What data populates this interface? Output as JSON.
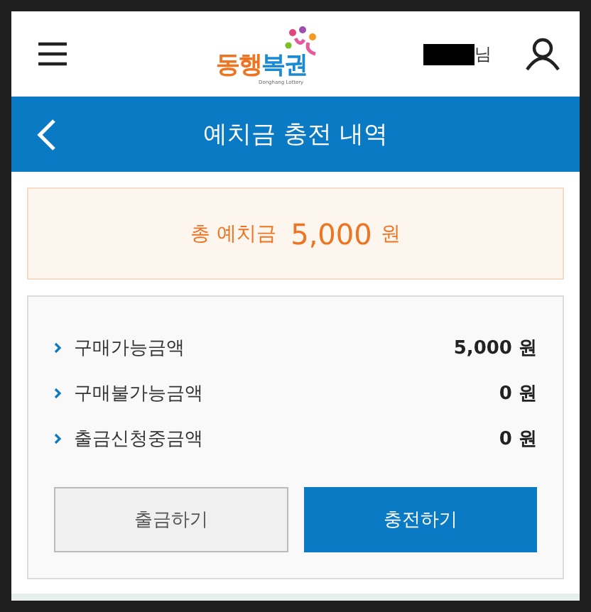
{
  "header": {
    "logo": {
      "part_1": "동행",
      "part_2": "복권",
      "tagline": "Donghang Lottery"
    },
    "user_suffix": "님"
  },
  "title_bar": {
    "title": "예치금 충전 내역"
  },
  "total": {
    "label": "총 예치금",
    "amount": "5,000",
    "unit": "원"
  },
  "balances": [
    {
      "label": "구매가능금액",
      "amount": "5,000",
      "unit": "원"
    },
    {
      "label": "구매불가능금액",
      "amount": "0",
      "unit": "원"
    },
    {
      "label": "출금신청중금액",
      "amount": "0",
      "unit": "원"
    }
  ],
  "buttons": [
    {
      "label": "출금하기",
      "kind": "secondary"
    },
    {
      "label": "충전하기",
      "kind": "primary"
    }
  ]
}
